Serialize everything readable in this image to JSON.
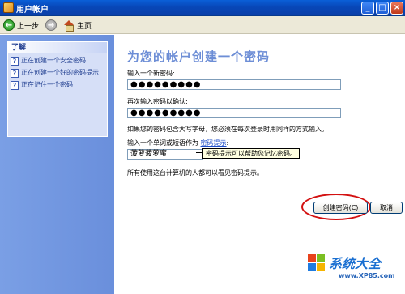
{
  "window": {
    "title": "用户帐户",
    "controls": {
      "minimize": "_",
      "maximize": "□",
      "close": "×"
    }
  },
  "toolbar": {
    "back_label": "上一步",
    "home_label": "主页"
  },
  "sidebar": {
    "header": "了解",
    "items": [
      {
        "label": "正在创建一个安全密码"
      },
      {
        "label": "正在创建一个好的密码提示"
      },
      {
        "label": "正在记住一个密码"
      }
    ]
  },
  "main": {
    "heading": "为您的帐户创建一个密码",
    "new_password_label": "输入一个新密码:",
    "new_password_value": "●●●●●●●●●",
    "confirm_password_label": "再次输入密码以确认:",
    "confirm_password_value": "●●●●●●●●●",
    "case_note": "如果您的密码包含大写字母，您必须在每次登录时用同样的方式输入。",
    "hint_label_prefix": "输入一个单词或短语作为",
    "hint_link": "密码提示",
    "hint_link_suffix": ":",
    "hint_value": "菠萝菠萝蜜",
    "hint_tooltip": "密码提示可以帮助您记忆密码。",
    "visibility_note": "所有使用这台计算机的人都可以看见密码提示。",
    "create_button": "创建密码(C)",
    "cancel_button": "取消"
  },
  "watermark": {
    "text": "系统大全",
    "url": "www.XP85.com"
  },
  "colors": {
    "titlebar": "#0a5fd8",
    "heading": "#6d8ed6",
    "sidebar": "#7a9fe5",
    "highlight": "#d31010"
  }
}
